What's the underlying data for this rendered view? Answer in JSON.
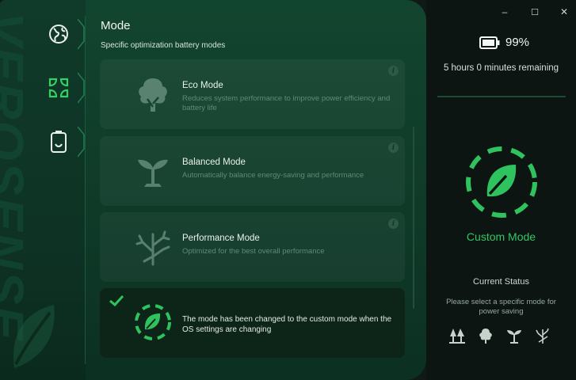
{
  "brand": {
    "vertical_text": "VEROSENSE"
  },
  "window": {
    "minimize": "–",
    "maximize": "☐",
    "close": "✕"
  },
  "nav": {
    "items": [
      {
        "name": "globe-icon",
        "active": false
      },
      {
        "name": "leaf-mode-icon",
        "active": true
      },
      {
        "name": "battery-icon",
        "active": false
      }
    ]
  },
  "main": {
    "title": "Mode",
    "subtitle": "Specific optimization battery modes",
    "cards": [
      {
        "name": "Eco Mode",
        "desc": "Reduces system performance to improve power efficiency and battery life",
        "icon": "tree-icon"
      },
      {
        "name": "Balanced Mode",
        "desc": "Automatically balance energy-saving and performance",
        "icon": "sprout-icon"
      },
      {
        "name": "Performance Mode",
        "desc": "Optimized for the best overall performance",
        "icon": "branch-icon"
      }
    ],
    "custom_message": "The mode has been changed to the custom mode when the OS settings are changing",
    "info_glyph": "i"
  },
  "status": {
    "battery_percent": "99%",
    "remaining": "5 hours 0 minutes remaining",
    "mode": "Custom Mode",
    "current_status_title": "Current Status",
    "current_status_desc": "Please select a specific mode for power saving"
  },
  "colors": {
    "accent": "#2fc35f",
    "panel": "#12452f",
    "muted_text": "#5c8c74"
  }
}
